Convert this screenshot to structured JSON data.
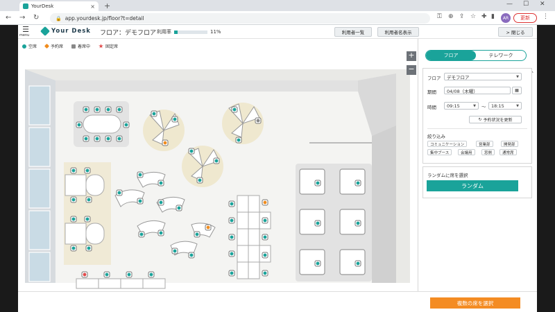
{
  "browser": {
    "tab_title": "YourDesk",
    "url": "app.yourdesk.jp/floor?t=detail",
    "profile_initials": "AR",
    "update_label": "更新",
    "new_tab": "+",
    "tab_close": "×"
  },
  "header": {
    "menu_label": "menu",
    "logo_text": "Your Desk",
    "floor_title": "フロア：デモフロア",
    "usage_label": "利用率",
    "usage_percent": "11%",
    "usage_fraction": 0.11,
    "btn_user_list": "利用者一覧",
    "btn_show_names": "利用者名表示",
    "btn_close": "> 閉じる"
  },
  "legend": [
    {
      "label": "空席",
      "color": "#1aa39a",
      "shape": "circle"
    },
    {
      "label": "予約席",
      "color": "#f08c1e",
      "shape": "diamond"
    },
    {
      "label": "着席中",
      "color": "#888888",
      "shape": "square"
    },
    {
      "label": "固定席",
      "color": "#e04a4a",
      "shape": "star"
    }
  ],
  "zoom": {
    "in": "+",
    "out": "−"
  },
  "panel": {
    "tab_floor": "フロア",
    "tab_telework": "テレワーク",
    "floor_label": "フロア",
    "floor_value": "デモフロア",
    "period_label": "期間",
    "period_value": "04/08（木曜）",
    "time_label": "時間",
    "time_from": "09:15",
    "time_sep": "〜",
    "time_to": "18:15",
    "update_btn": "予約状況を更新",
    "filter_label": "絞り込み",
    "filters": [
      "コミュニケーション",
      "営業部",
      "開発部",
      "集中ブース",
      "会議用",
      "窓側",
      "通常席"
    ],
    "random_label": "ランダムに席を選択",
    "random_btn": "ランダム"
  },
  "footer": {
    "multi_btn": "複数の席を選択"
  }
}
